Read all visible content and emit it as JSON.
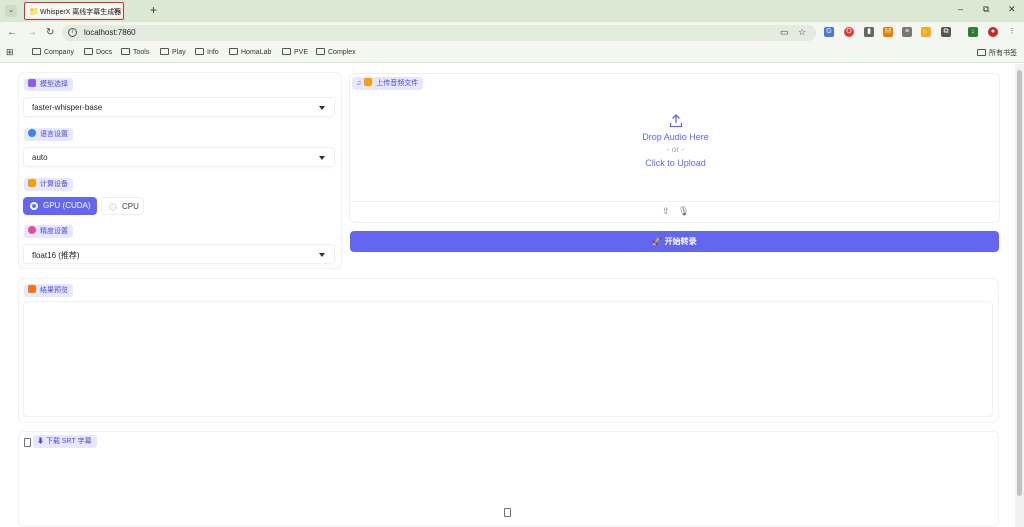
{
  "browser": {
    "tab_title": "WhisperX 离线字幕生成器",
    "tab_favicon": "📁",
    "url": "localhost:7860",
    "win_controls": [
      "–",
      "⧉",
      "✕"
    ],
    "bookmarks": [
      "Company",
      "Docs",
      "Tools",
      "Play",
      "Info",
      "HomaLab",
      "PVE",
      "Complex"
    ],
    "all_bookmarks": "所有书签"
  },
  "model": {
    "label": "模型选择",
    "value": "faster-whisper-base"
  },
  "language": {
    "label": "语言设置",
    "value": "auto"
  },
  "device": {
    "label": "计算设备",
    "options": [
      "GPU (CUDA)",
      "CPU"
    ],
    "selected": "GPU (CUDA)"
  },
  "precision": {
    "label": "精度设置",
    "value": "float16 (推荐)"
  },
  "upload": {
    "label": "上传音频文件",
    "drop_text": "Drop Audio Here",
    "or_text": "- or -",
    "click_text": "Click to Upload"
  },
  "start_button": {
    "label": "🚀 开始转录"
  },
  "result": {
    "label": "结果预览"
  },
  "download": {
    "label": "⬇ 下载 SRT 字幕"
  },
  "colors": {
    "accent": "#6366f1",
    "chip_bg": "#e6e8fd",
    "tab_highlight": "#d32f2f"
  }
}
